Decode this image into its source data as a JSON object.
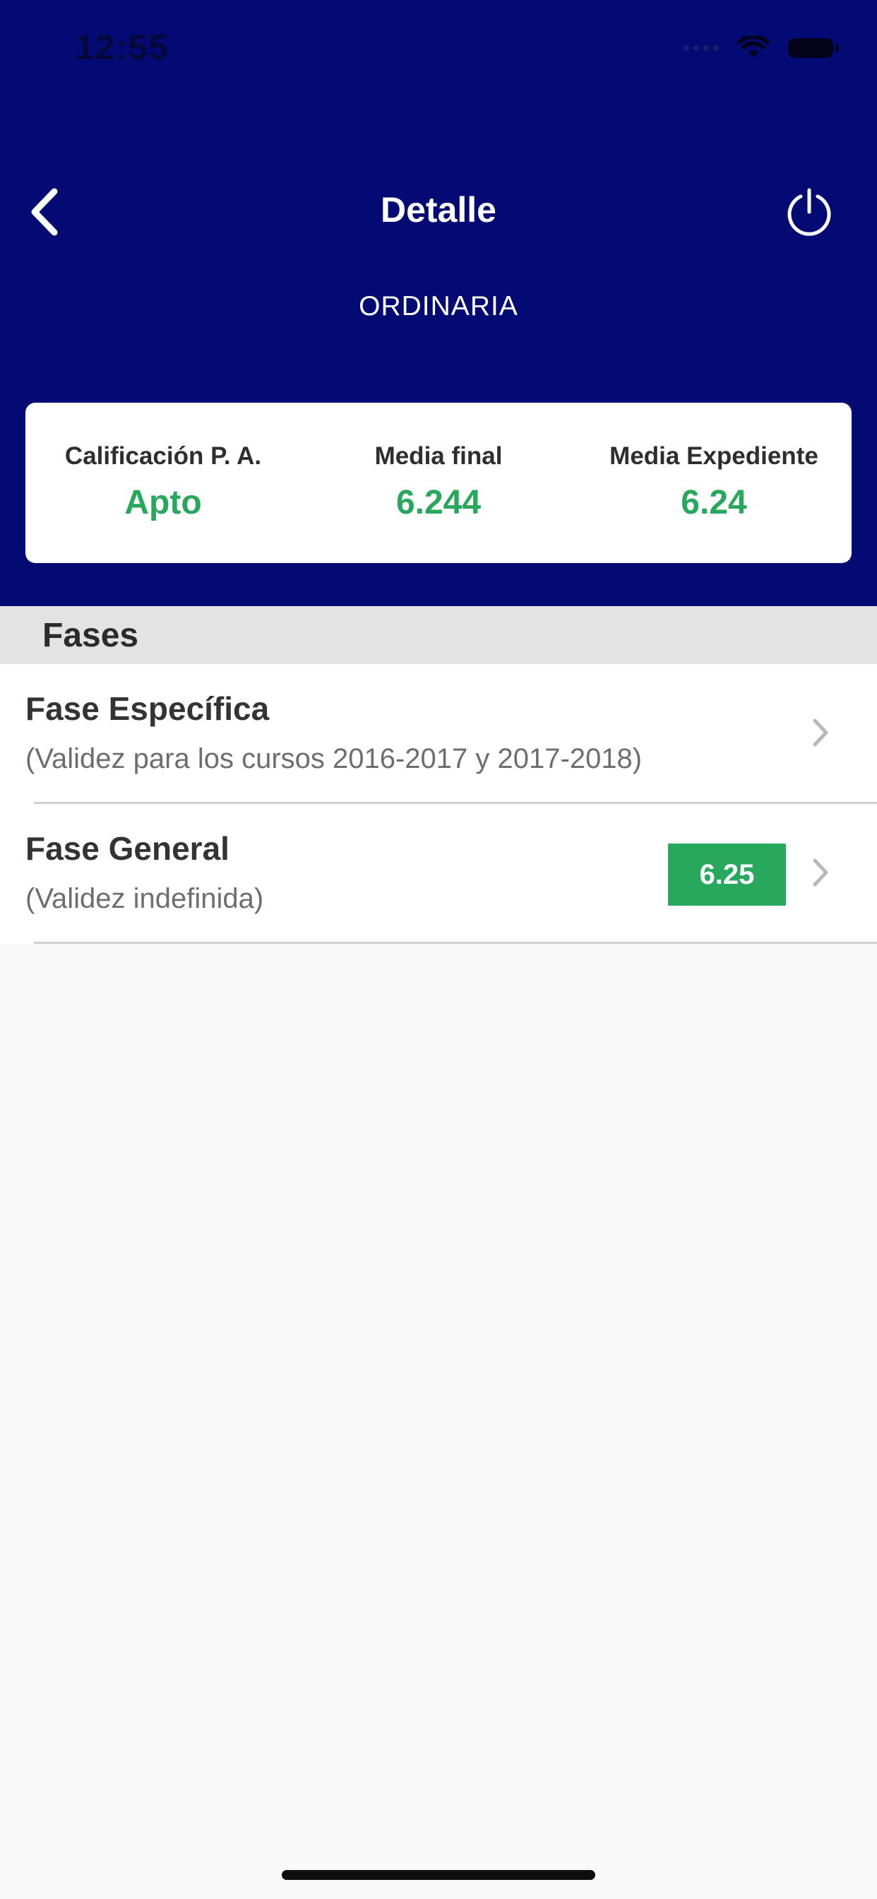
{
  "status_bar": {
    "time": "12:55",
    "icons": [
      "signal-icon",
      "wifi-icon",
      "battery-icon"
    ]
  },
  "nav": {
    "title": "Detalle",
    "subtitle": "ORDINARIA",
    "back_icon": "chevron-left-icon",
    "power_icon": "power-icon"
  },
  "summary": {
    "items": [
      {
        "label": "Calificación P. A.",
        "value": "Apto"
      },
      {
        "label": "Media final",
        "value": "6.244"
      },
      {
        "label": "Media Expediente",
        "value": "6.24"
      }
    ]
  },
  "section": {
    "title": "Fases"
  },
  "phases": [
    {
      "title": "Fase Específica",
      "subtitle": "(Validez para los cursos 2016-2017 y 2017-2018)",
      "grade": ""
    },
    {
      "title": "Fase General",
      "subtitle": "(Validez indefinida)",
      "grade": "6.25"
    }
  ],
  "colors": {
    "header_bg": "#040a73",
    "accent_green": "#27a85c",
    "section_bg": "#e3e3e3",
    "page_bg": "#f9f9f9"
  }
}
